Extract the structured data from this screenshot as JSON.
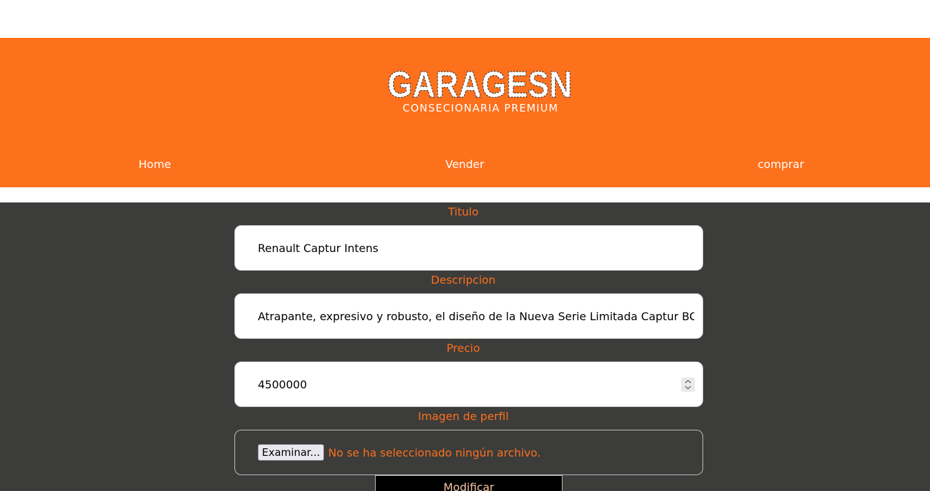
{
  "brand": {
    "logo_text": "GARAGESN",
    "tagline": "CONSECIONARIA PREMIUM",
    "header_color": "#fd701c"
  },
  "nav": {
    "items": [
      {
        "label": "Home"
      },
      {
        "label": "Vender"
      },
      {
        "label": "comprar"
      }
    ]
  },
  "form": {
    "titulo": {
      "label": "Titulo",
      "value": "Renault Captur Intens"
    },
    "descripcion": {
      "label": "Descripcion",
      "value": "Atrapante, expresivo y robusto, el diseño de la Nueva Serie Limitada Captur BOSE ®, te"
    },
    "precio": {
      "label": "Precio",
      "value": "4500000"
    },
    "imagen": {
      "label": "Imagen de perfil",
      "button_label": "Examinar...",
      "status": "No se ha seleccionado ningún archivo."
    },
    "submit_label": "Modificar"
  },
  "colors": {
    "accent": "#fd701c",
    "background_dark": "#3c3c3b"
  },
  "icons": {
    "spinner": "number-spinner-icon"
  }
}
